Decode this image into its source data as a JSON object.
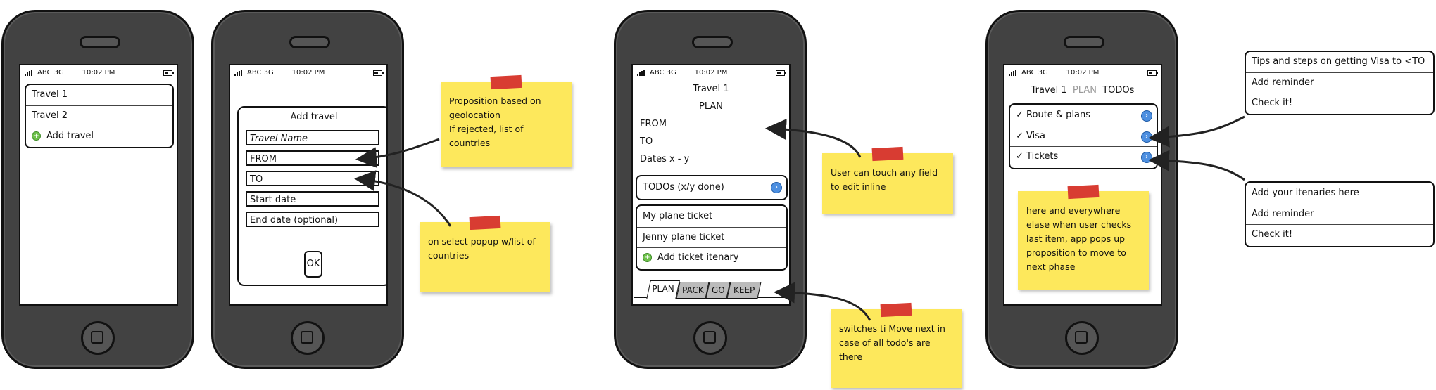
{
  "status": {
    "carrier": "ABC 3G",
    "time": "10:02 PM"
  },
  "screen1": {
    "items": [
      "Travel 1",
      "Travel 2"
    ],
    "add_label": "Add travel"
  },
  "screen2": {
    "title": "Add travel",
    "fields": [
      "Travel Name",
      "FROM",
      "TO",
      "Start date",
      "End date (optional)"
    ],
    "ok_label": "OK"
  },
  "screen3": {
    "title": "Travel 1",
    "subtitle": "PLAN",
    "lines": [
      "FROM",
      "TO",
      "Dates x - y"
    ],
    "todos_label": "TODOs (x/y done)",
    "tickets": [
      "My plane ticket",
      "Jenny plane ticket"
    ],
    "add_ticket_label": "Add ticket itenary",
    "tabs": [
      "PLAN",
      "PACK",
      "GO",
      "KEEP"
    ]
  },
  "screen4": {
    "breadcrumb": [
      "Travel 1",
      "PLAN",
      "TODOs"
    ],
    "todos": [
      "Route & plans",
      "Visa",
      "Tickets"
    ],
    "check_mark": "✓"
  },
  "notes": {
    "geolocation": [
      "Proposition based on",
      "geolocation",
      "If rejected, list of",
      "countries"
    ],
    "popup": [
      "on select popup w/list of",
      "countries"
    ],
    "inline": [
      "User can touch any field",
      "to edit inline"
    ],
    "switch": [
      "switches ti Move next in",
      "case of all todo's are",
      "there"
    ],
    "phase": [
      "here and everywhere",
      "elase when user checks",
      "last item, app pops up",
      "proposition to move to",
      "next phase"
    ]
  },
  "callouts": {
    "visa": [
      "Tips and steps on getting Visa to <TO",
      "Add reminder",
      "Check it!"
    ],
    "tickets": [
      "Add your itenaries here",
      "Add reminder",
      "Check it!"
    ]
  },
  "colors": {
    "note": "#fde85c",
    "tape": "#d83c32",
    "phone": "#424242",
    "add_icon": "#6ec04b",
    "chevron": "#4d8fe0"
  }
}
